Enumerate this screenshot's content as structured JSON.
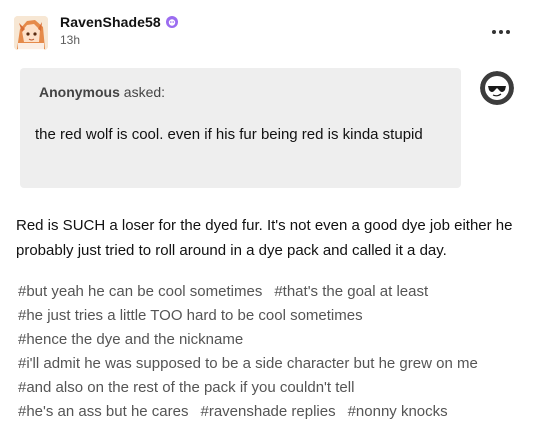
{
  "post": {
    "author": "RavenShade58",
    "timestamp": "13h"
  },
  "ask": {
    "asker": "Anonymous",
    "asked_label": "asked:",
    "question": "the red wolf is cool. even if his fur being red is kinda stupid"
  },
  "reply": {
    "text": "Red is SUCH a loser for the dyed fur. It's not even a good dye job either he probably just tried to roll around in a dye pack and called it a day."
  },
  "tags": {
    "line1": [
      "#but yeah he can be cool sometimes",
      "#that's the goal at least"
    ],
    "line2": [
      "#he just tries a little TOO hard to be cool sometimes"
    ],
    "line3": [
      "#hence the dye and the nickname"
    ],
    "line4": [
      "#i'll admit he was supposed to be a side character but he grew on me"
    ],
    "line5": [
      "#and also on the rest of the pack if you couldn't tell"
    ],
    "line6": [
      "#he's an ass but he cares",
      "#ravenshade replies",
      "#nonny knocks"
    ]
  },
  "icons": {
    "badge": "purple-crab-badge-icon",
    "more": "more-options-icon",
    "asker_avatar": "anonymous-sunglasses-avatar-icon"
  },
  "colors": {
    "ask_background": "#eeeeee",
    "tag_text": "#555555",
    "badge_purple": "#9b6cf0"
  }
}
